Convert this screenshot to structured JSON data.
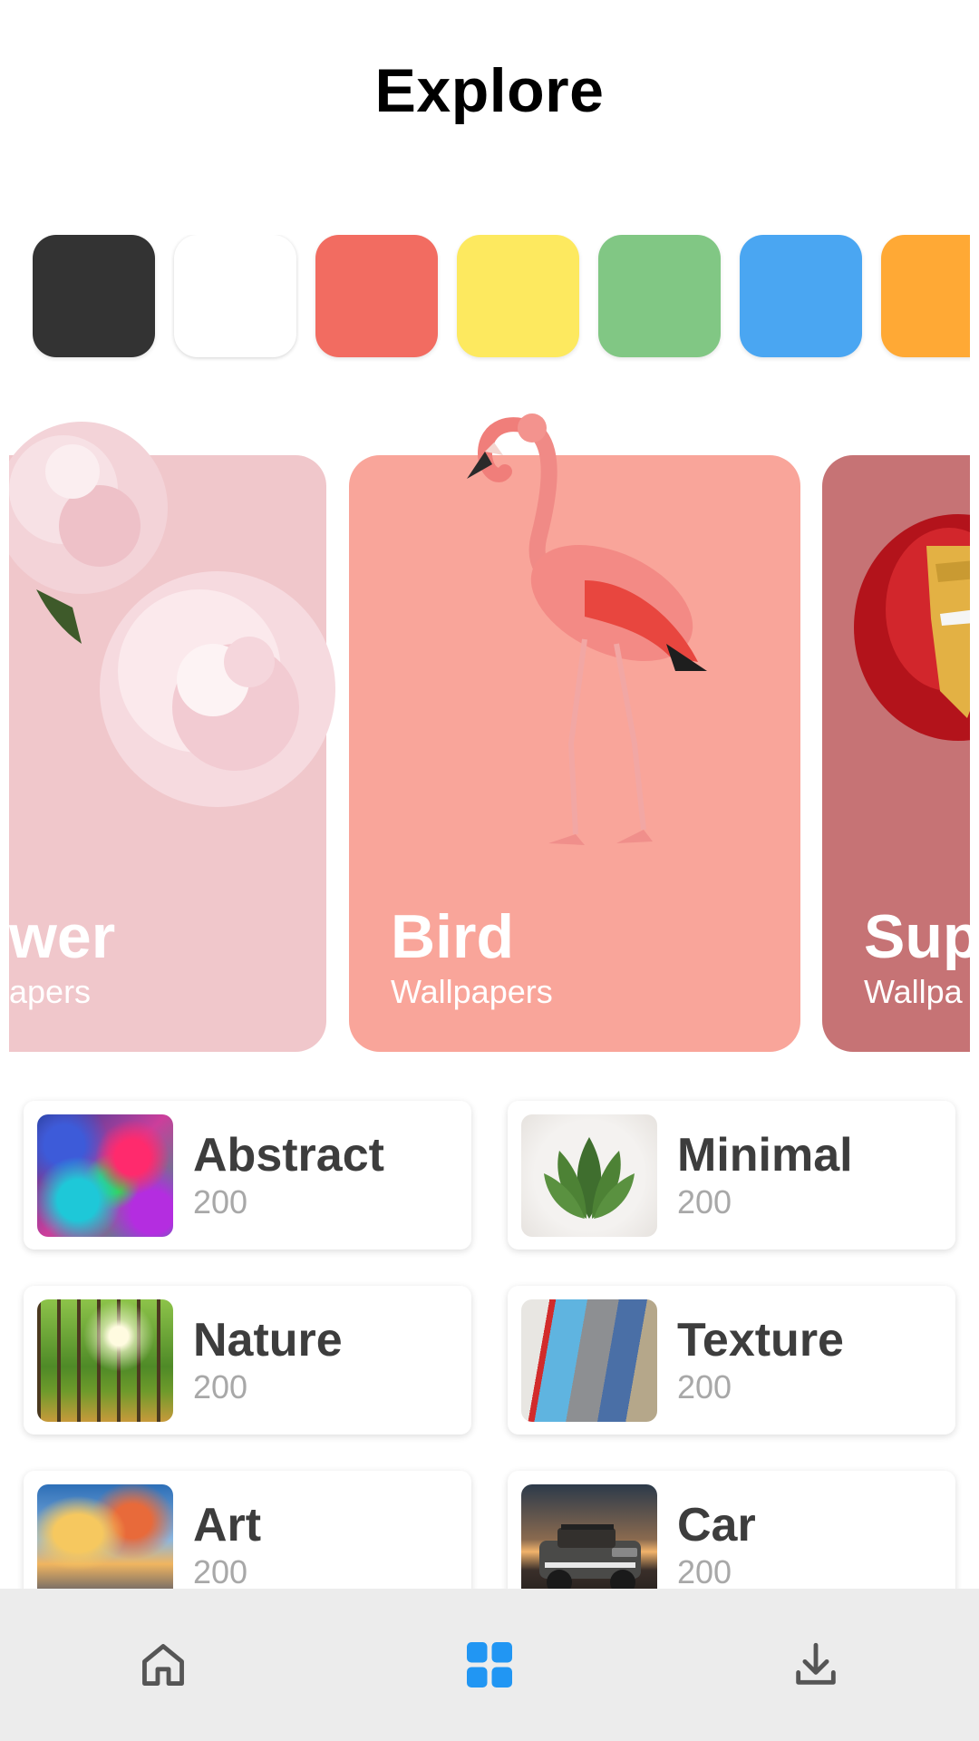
{
  "header": {
    "title": "Explore"
  },
  "colors": {
    "swatches": [
      {
        "name": "black",
        "hex": "#333333"
      },
      {
        "name": "white",
        "hex": "#ffffff"
      },
      {
        "name": "red",
        "hex": "#f26c61"
      },
      {
        "name": "yellow",
        "hex": "#fde95f"
      },
      {
        "name": "green",
        "hex": "#81c784"
      },
      {
        "name": "blue",
        "hex": "#4aa6f2"
      },
      {
        "name": "orange",
        "hex": "#ffa935"
      }
    ]
  },
  "featured": {
    "cards": [
      {
        "title": "wer",
        "subtitle": "apers",
        "color": "#f0c7cb",
        "icon": "peony-flower"
      },
      {
        "title": "Bird",
        "subtitle": "Wallpapers",
        "color": "#f9a59a",
        "icon": "flamingo"
      },
      {
        "title": "Sup",
        "subtitle": "Wallpa",
        "color": "#c67375",
        "icon": "iron-man-helmet"
      }
    ]
  },
  "categories": {
    "items": [
      {
        "name": "Abstract",
        "count": "200"
      },
      {
        "name": "Minimal",
        "count": "200"
      },
      {
        "name": "Nature",
        "count": "200"
      },
      {
        "name": "Texture",
        "count": "200"
      },
      {
        "name": "Art",
        "count": "200"
      },
      {
        "name": "Car",
        "count": "200"
      }
    ]
  },
  "nav": {
    "items": [
      {
        "icon": "home-icon",
        "active": false
      },
      {
        "icon": "grid-icon",
        "active": true
      },
      {
        "icon": "download-icon",
        "active": false
      }
    ],
    "active_color": "#2196f3",
    "inactive_color": "#555555"
  }
}
